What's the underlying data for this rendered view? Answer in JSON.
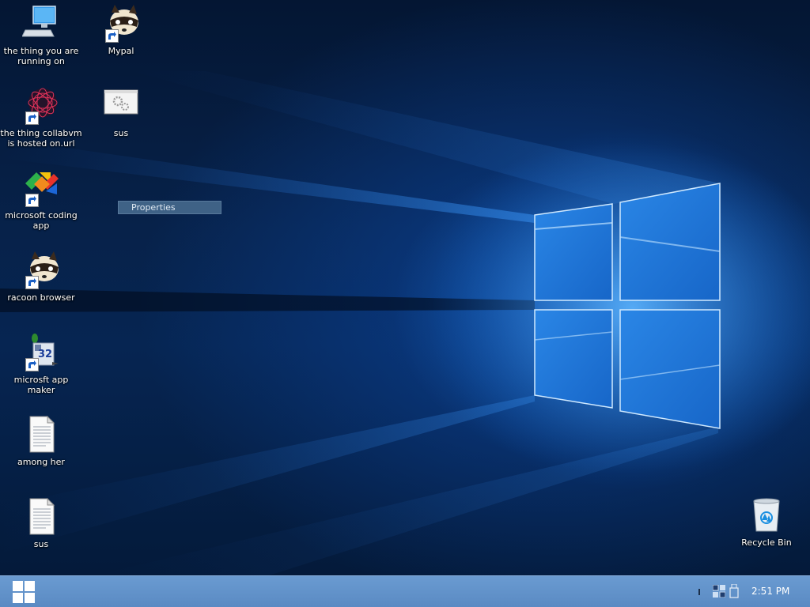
{
  "desktop": {
    "icons": [
      {
        "label": "the thing you are running on"
      },
      {
        "label": "Mypal"
      },
      {
        "label": "the thing collabvm is hosted on.url"
      },
      {
        "label": "sus"
      },
      {
        "label": "microsoft coding app"
      },
      {
        "label": "racoon browser"
      },
      {
        "label": "microsft app maker"
      },
      {
        "label": "among her"
      },
      {
        "label": "sus"
      },
      {
        "label": "Recycle Bin"
      }
    ]
  },
  "context_menu": {
    "properties_label": "Properties"
  },
  "taskbar": {
    "clock": "2:51 PM",
    "start_icon": "windows-logo-icon",
    "tray_icons": [
      "network-icon",
      "usb-icon"
    ]
  },
  "colors": {
    "taskbar": "#5a8ac3",
    "desktop_dark": "#041633",
    "accent_blue": "#2d8ce8"
  }
}
